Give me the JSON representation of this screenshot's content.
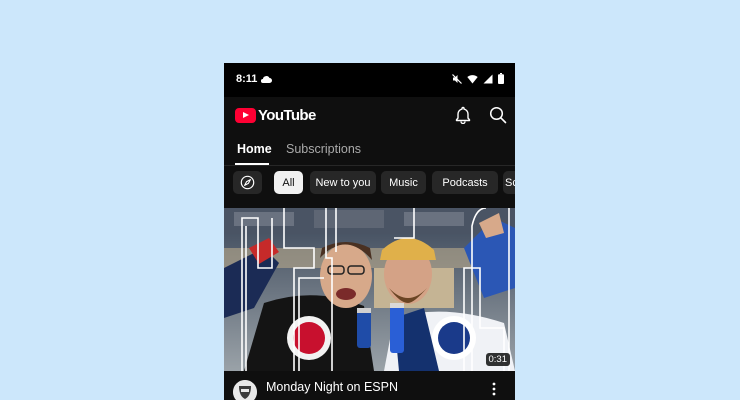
{
  "status_bar": {
    "time": "8:11",
    "icons": [
      "cloud-icon",
      "mute-icon",
      "wifi-icon",
      "signal-icon",
      "battery-icon"
    ]
  },
  "app_bar": {
    "logo_text": "YouTube",
    "icons": [
      "notifications-bell-icon",
      "search-icon"
    ]
  },
  "tabs": [
    {
      "label": "Home",
      "selected": true
    },
    {
      "label": "Subscriptions",
      "selected": false
    }
  ],
  "chips": [
    {
      "label": "All",
      "selected": true
    },
    {
      "label": "New to you"
    },
    {
      "label": "Music"
    },
    {
      "label": "Podcasts"
    },
    {
      "label": "Sc"
    }
  ],
  "video": {
    "duration": "0:31",
    "title": "Monday Night on ESPN"
  },
  "colors": {
    "background": "#cce7fb",
    "app_bg": "#0f0f0f",
    "brand_red": "#ff0033",
    "chip_bg": "#272727",
    "chip_selected_bg": "#f1f1f1"
  }
}
